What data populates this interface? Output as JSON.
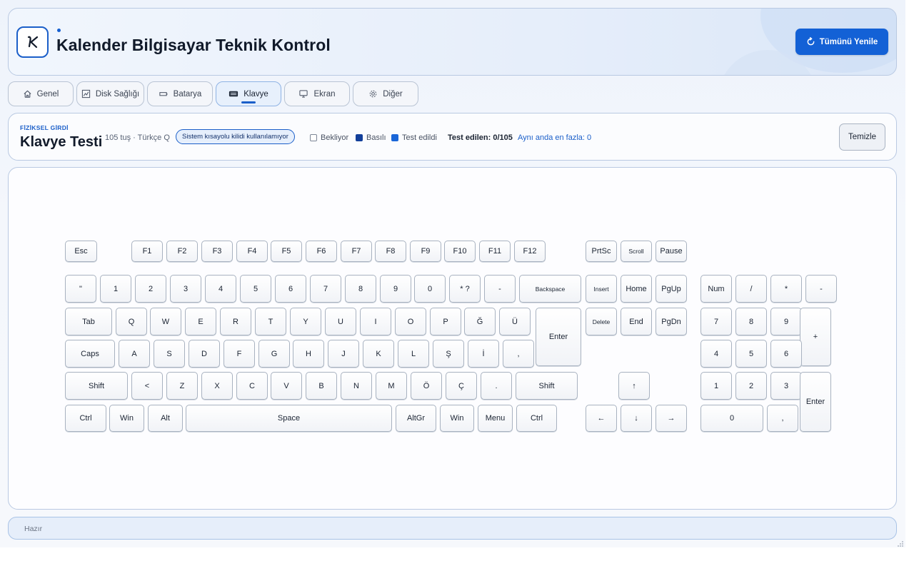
{
  "header": {
    "title": "Kalender Bilgisayar Teknik Kontrol",
    "refresh_label": "Tümünü Yenile",
    "accent": "#1361d6"
  },
  "tabs": [
    {
      "id": "genel",
      "label": "Genel",
      "icon": "home-icon"
    },
    {
      "id": "disk",
      "label": "Disk Sağlığı",
      "icon": "disk-chart-icon"
    },
    {
      "id": "batarya",
      "label": "Batarya",
      "icon": "battery-icon"
    },
    {
      "id": "klavye",
      "label": "Klavye",
      "icon": "keyboard-icon",
      "active": true
    },
    {
      "id": "ekran",
      "label": "Ekran",
      "icon": "monitor-icon"
    },
    {
      "id": "diger",
      "label": "Diğer",
      "icon": "gear-icon"
    }
  ],
  "test": {
    "kicker": "FİZİKSEL GİRDİ",
    "title": "Klavye Testi",
    "meta": "105 tuş · Türkçe Q",
    "lock_label": "Sistem kısayolu kilidi kullanılamıyor",
    "legend": {
      "waiting": "Bekliyor",
      "pressed": "Basılı",
      "tested": "Test edildi"
    },
    "tested_count": "Test edilen: 0/105",
    "max_simultaneous": "Aynı anda en fazla: 0",
    "clear_label": "Temizle"
  },
  "keys": {
    "esc": "Esc",
    "f1": "F1",
    "f2": "F2",
    "f3": "F3",
    "f4": "F4",
    "f5": "F5",
    "f6": "F6",
    "f7": "F7",
    "f8": "F8",
    "f9": "F9",
    "f10": "F10",
    "f11": "F11",
    "f12": "F12",
    "prtsc": "PrtSc",
    "scroll": "Scroll",
    "pause": "Pause",
    "quote": "\"",
    "d1": "1",
    "d2": "2",
    "d3": "3",
    "d4": "4",
    "d5": "5",
    "d6": "6",
    "d7": "7",
    "d8": "8",
    "d9": "9",
    "d0": "0",
    "star_q": "* ?",
    "minus": "-",
    "backspace": "Backspace",
    "insert": "Insert",
    "home": "Home",
    "pgup": "PgUp",
    "num": "Num",
    "np_div": "/",
    "np_mul": "*",
    "np_sub": "-",
    "tab": "Tab",
    "q": "Q",
    "w": "W",
    "e": "E",
    "r": "R",
    "t": "T",
    "y": "Y",
    "u": "U",
    "i": "I",
    "o": "O",
    "p": "P",
    "gbreve": "Ğ",
    "uuml": "Ü",
    "enter": "Enter",
    "delete": "Delete",
    "end": "End",
    "pgdn": "PgDn",
    "np7": "7",
    "np8": "8",
    "np9": "9",
    "np_add": "+",
    "caps": "Caps",
    "a": "A",
    "s": "S",
    "d": "D",
    "f": "F",
    "g": "G",
    "h": "H",
    "j": "J",
    "k": "K",
    "l": "L",
    "scedil": "Ş",
    "idot": "İ",
    "comma": ",",
    "np4": "4",
    "np5": "5",
    "np6": "6",
    "lshift": "Shift",
    "lt": "<",
    "z": "Z",
    "x": "X",
    "c": "C",
    "v": "V",
    "b": "B",
    "n": "N",
    "m": "M",
    "ouml": "Ö",
    "ccedil": "Ç",
    "dot": ".",
    "rshift": "Shift",
    "up": "↑",
    "np1": "1",
    "np2": "2",
    "np3": "3",
    "np_enter": "Enter",
    "lctrl": "Ctrl",
    "lwin": "Win",
    "alt": "Alt",
    "space": "Space",
    "altgr": "AltGr",
    "rwin": "Win",
    "menu": "Menu",
    "rctrl": "Ctrl",
    "left": "←",
    "down": "↓",
    "right": "→",
    "np0": "0",
    "np_dec": ","
  },
  "status": {
    "text": "Hazır"
  }
}
